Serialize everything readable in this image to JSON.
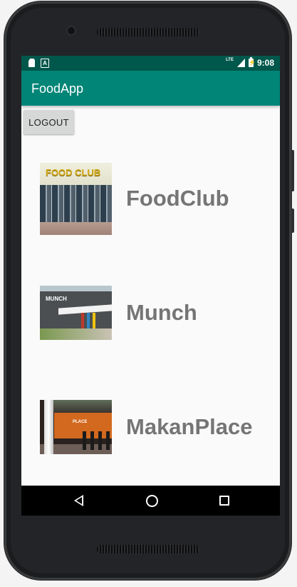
{
  "status_bar": {
    "time": "9:08",
    "network": "LTE",
    "icons": [
      "sd-card-icon",
      "a-notification-icon",
      "signal-icon",
      "battery-charging-icon"
    ]
  },
  "app_bar": {
    "title": "FoodApp"
  },
  "logout_button": {
    "label": "LOGOUT"
  },
  "restaurants": [
    {
      "name": "FoodClub",
      "thumbnail_text": "FOOD CLUB"
    },
    {
      "name": "Munch",
      "thumbnail_text": "MUNCH"
    },
    {
      "name": "MakanPlace",
      "thumbnail_text": "PLACE"
    }
  ],
  "nav_bar": {
    "icons": [
      "back-icon",
      "home-icon",
      "recents-icon"
    ]
  },
  "colors": {
    "status_bar": "#00574b",
    "app_bar": "#008577",
    "restaurant_text": "#757575",
    "screen_bg": "#fafafa"
  }
}
